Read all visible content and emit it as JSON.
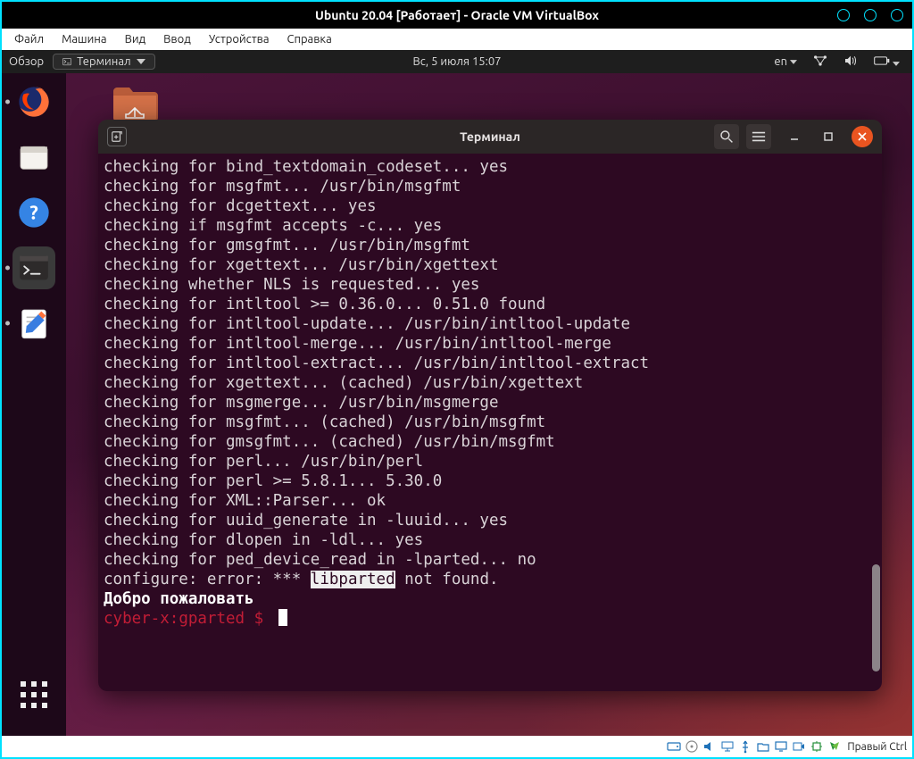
{
  "vbox": {
    "title": "Ubuntu 20.04 [Работает] - Oracle VM VirtualBox",
    "menu": [
      "Файл",
      "Машина",
      "Вид",
      "Ввод",
      "Устройства",
      "Справка"
    ],
    "status_text": "Правый Ctrl"
  },
  "gnome": {
    "activities": "Обзор",
    "term_dropdown": "Терминал",
    "clock": "Вс, 5 июля  15:07",
    "lang": "en"
  },
  "terminal": {
    "title": "Терминал",
    "lines": [
      "checking for bind_textdomain_codeset... yes",
      "checking for msgfmt... /usr/bin/msgfmt",
      "checking for dcgettext... yes",
      "checking if msgfmt accepts -c... yes",
      "checking for gmsgfmt... /usr/bin/msgfmt",
      "checking for xgettext... /usr/bin/xgettext",
      "checking whether NLS is requested... yes",
      "checking for intltool >= 0.36.0... 0.51.0 found",
      "checking for intltool-update... /usr/bin/intltool-update",
      "checking for intltool-merge... /usr/bin/intltool-merge",
      "checking for intltool-extract... /usr/bin/intltool-extract",
      "checking for xgettext... (cached) /usr/bin/xgettext",
      "checking for msgmerge... /usr/bin/msgmerge",
      "checking for msgfmt... (cached) /usr/bin/msgfmt",
      "checking for gmsgfmt... (cached) /usr/bin/msgfmt",
      "checking for perl... /usr/bin/perl",
      "checking for perl >= 5.8.1... 5.30.0",
      "checking for XML::Parser... ok",
      "checking for uuid_generate in -luuid... yes",
      "checking for dlopen in -ldl... yes",
      "checking for ped_device_read in -lparted... no"
    ],
    "error_pre": "configure: error: *** ",
    "error_highlight": "libparted",
    "error_post": " not found.",
    "welcome": "Добро пожаловать",
    "prompt_user": "cyber-x",
    "prompt_sep": ":",
    "prompt_dir": "gparted",
    "prompt_sym": " $ "
  }
}
